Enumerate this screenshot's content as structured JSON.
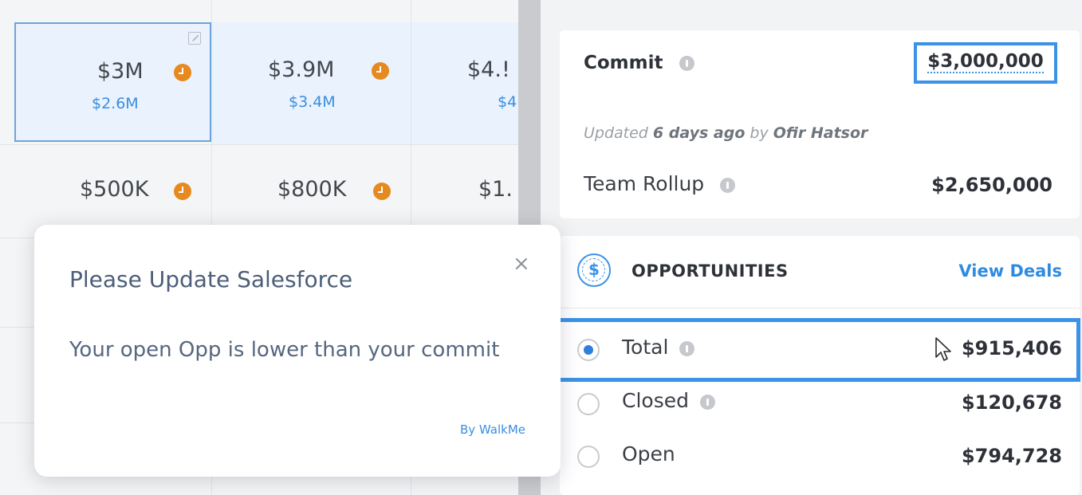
{
  "forecast_grid": {
    "row1": [
      {
        "amount": "$3M",
        "sub": "$2.6M"
      },
      {
        "amount": "$3.9M",
        "sub": "$3.4M"
      },
      {
        "amount": "$4.!",
        "sub": "$4"
      }
    ],
    "row2": [
      {
        "amount": "$500K"
      },
      {
        "amount": "$800K"
      },
      {
        "amount": "$1."
      }
    ]
  },
  "commit": {
    "label": "Commit",
    "value": "$3,000,000",
    "updated_prefix": "Updated ",
    "updated_when": "6 days ago",
    "updated_by_prefix": " by ",
    "updated_by": "Ofir Hatsor"
  },
  "team_rollup": {
    "label": "Team Rollup",
    "value": "$2,650,000"
  },
  "opportunities": {
    "title": "OPPORTUNITIES",
    "view_deals": "View Deals",
    "dollar_symbol": "$",
    "rows": [
      {
        "label": "Total",
        "value": "$915,406",
        "selected": true
      },
      {
        "label": "Closed",
        "value": "$120,678",
        "selected": false
      },
      {
        "label": "Open",
        "value": "$794,728",
        "selected": false
      }
    ]
  },
  "popup": {
    "title": "Please Update Salesforce",
    "body": "Your open Opp is lower than your commit",
    "close": "×",
    "by": "By WalkMe"
  },
  "colors": {
    "accent": "#3a93e6",
    "clock": "#e6891f",
    "link": "#2f8be0"
  }
}
